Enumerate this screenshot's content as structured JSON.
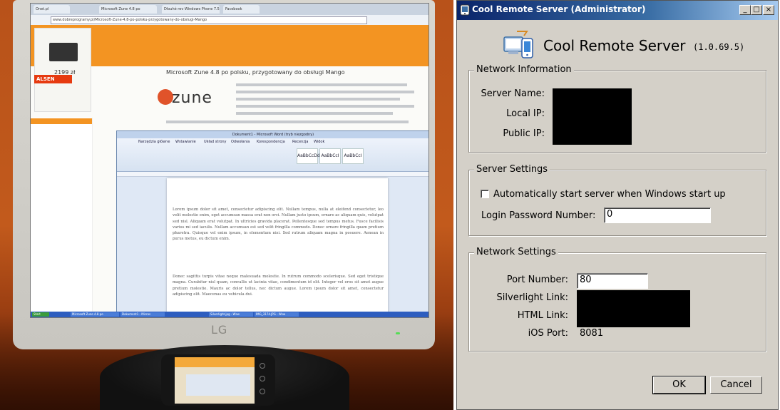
{
  "photo": {
    "monitor_brand": "LG",
    "browser_tabs": [
      "Onet.pl",
      "Microsoft Zune 4.8 po",
      "Dlouhé rev Windows Phone 7.5",
      "Facebook"
    ],
    "url": "www.dobreprogramy.pl/Microsoft-Zune-4.8-po-polsku-przygotowany-do-obslugi-Mango",
    "ad_price": "2199 zł",
    "ad_brand": "ALSEN",
    "article_heading": "Microsoft Zune 4.8 po polsku, przygotowany do obsługi Mango",
    "zune_logo": "zune",
    "word_title": "Dokument1 - Microsoft Word (tryb niezgodny)",
    "word_tabs": [
      "Narzędzia główne",
      "Wstawianie",
      "Układ strony",
      "Odwołania",
      "Korespondencja",
      "Recenzja",
      "Widok"
    ],
    "word_styles": [
      "AaBbCcDd",
      "AaBbCcI",
      "AaBbCcI"
    ],
    "word_text": "Lorem ipsum dolor sit amet, consectetur adipiscing elit. Nullam tempus, nulla at eleifend consectetur, leo velit molestie enim, eget accumsan massa erat non orci. Nullam justo ipsum, ornare ac aliquam quis, volutpat sed nisl. Aliquam erat volutpat. In ultricies gravida placerat. Pellentesque sed tempus metus. Fusce facilisis varius mi sed iaculis. Nullam accumsan est sed velit fringilla commodo. Donec ornare fringilla quam pretium pharetra. Quisque vel enim ipsum, in elementum nisi. Sed rutrum aliquam magna in posuere. Aenean in purus metus, eu dictum enim.",
    "word_text2": "Donec sagittis turpis vitae neque malesuada molestie. In rutrum commodo scelerisque. Sed eget tristique magna. Curabitur nisl quam, convallis ut lacinia vitae, condimentum id elit. Integer vel eros sit amet augue pretium molestie. Mauris ac dolor tellus, nec dictum augue. Lorem ipsum dolor sit amet, consectetur adipiscing elit. Maecenas eu vehicula dui.",
    "taskbar_items": [
      "Start",
      "Microsoft Zune 4.8 po",
      "Dokument1 - Micros",
      "Silverlight.jpg - Wsw",
      "IMG_3174.JPG - Wsw"
    ]
  },
  "dialog": {
    "title": "Cool Remote Server (Administrator)",
    "app_title": "Cool Remote Server",
    "version": "(1.0.69.5)",
    "network_info": {
      "legend": "Network Information",
      "server_name_label": "Server Name:",
      "local_ip_label": "Local IP:",
      "public_ip_label": "Public IP:"
    },
    "server_settings": {
      "legend": "Server Settings",
      "autostart_label": "Automatically start server when Windows start up",
      "autostart_checked": false,
      "password_label": "Login Password Number:",
      "password_value": "0"
    },
    "network_settings": {
      "legend": "Network Settings",
      "port_label": "Port Number:",
      "port_value": "80",
      "silverlight_label": "Silverlight Link:",
      "html_label": "HTML Link:",
      "ios_port_label": "iOS Port:",
      "ios_port_value": "8081"
    },
    "buttons": {
      "ok": "OK",
      "cancel": "Cancel"
    },
    "window_controls": {
      "minimize": "_",
      "maximize": "□",
      "close": "×"
    }
  }
}
